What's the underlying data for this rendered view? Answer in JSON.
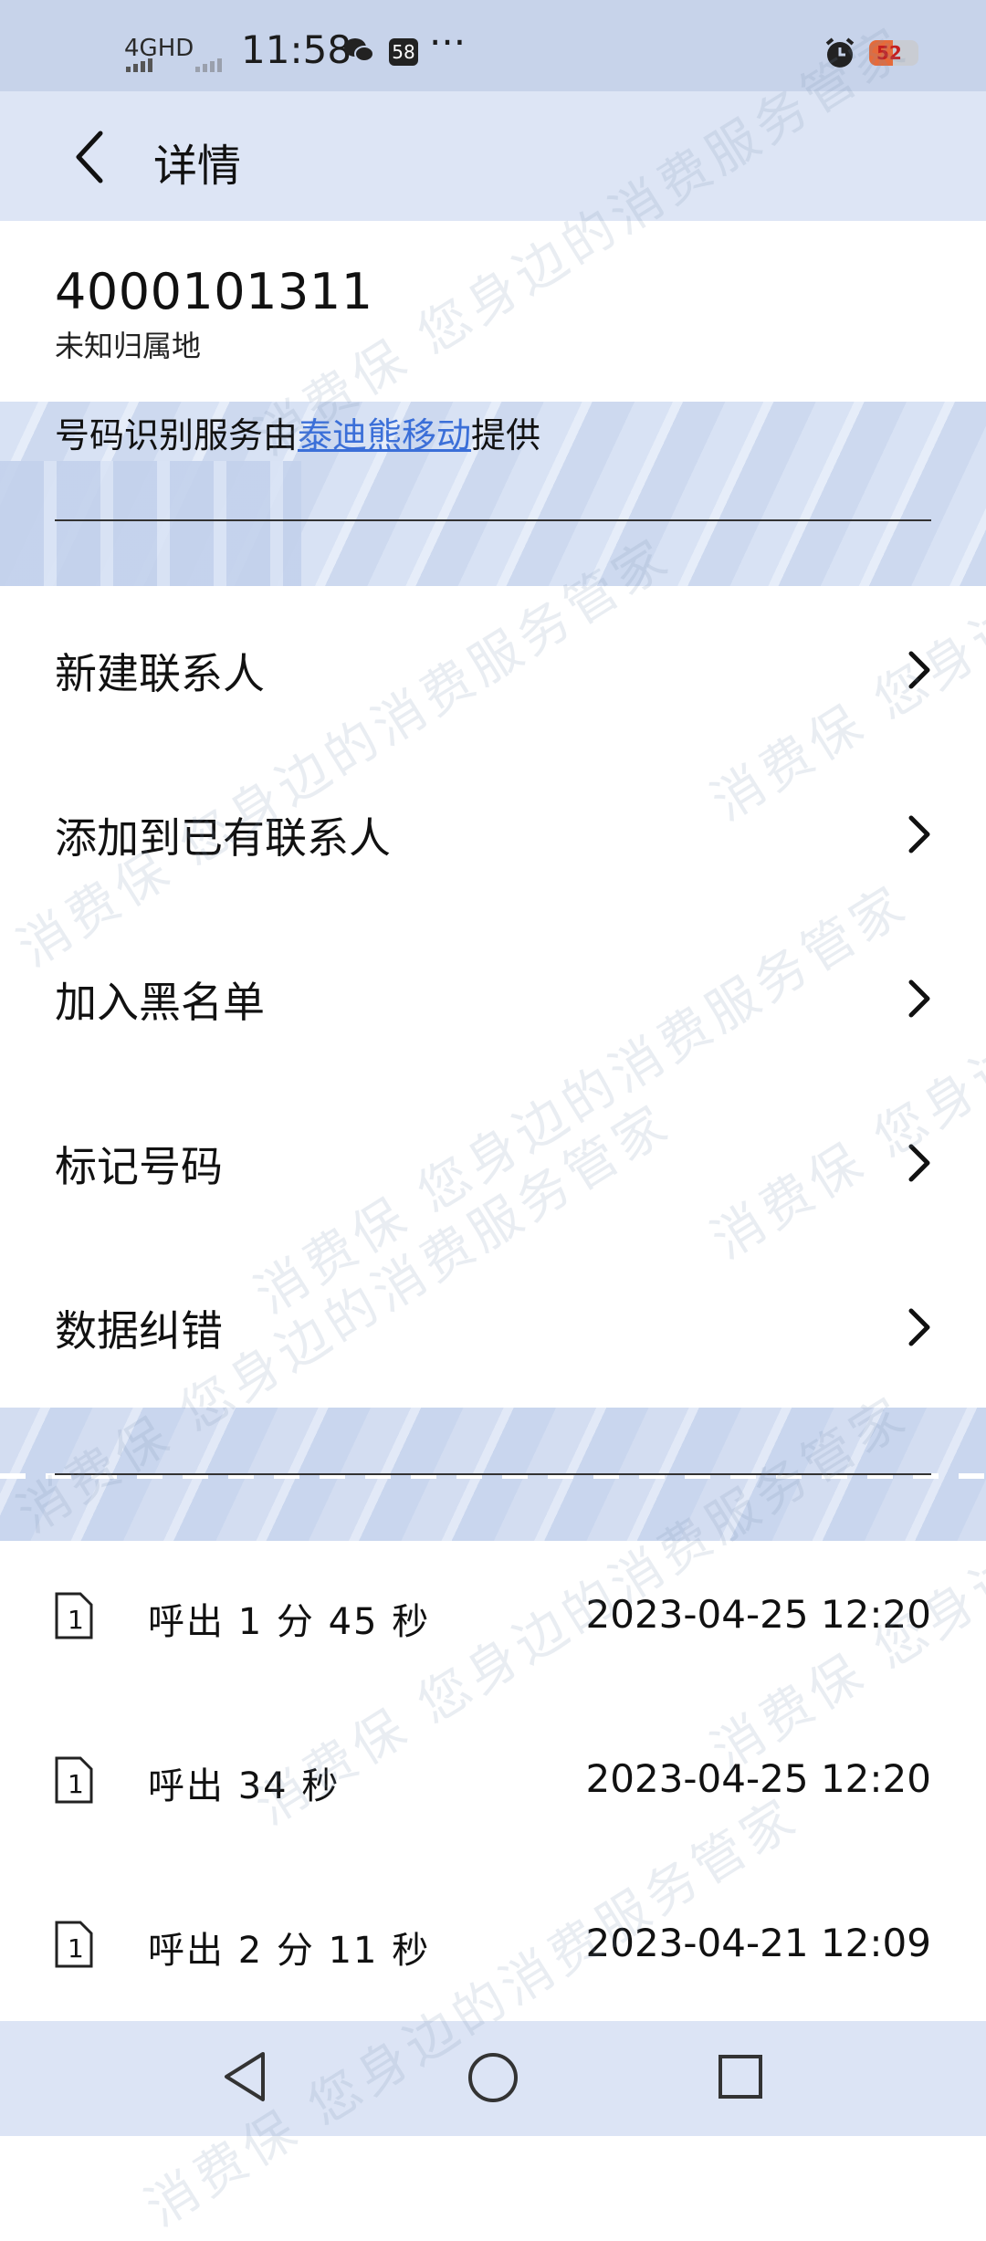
{
  "status_bar": {
    "network": "4GHD",
    "time": "11:58",
    "notification_count": "58",
    "more": "···",
    "battery": "52"
  },
  "header": {
    "title": "详情"
  },
  "caller": {
    "number": "4000101311",
    "location": "未知归属地",
    "provider_prefix": "号码识别服务由",
    "provider_link": "泰迪熊移动",
    "provider_suffix": "提供"
  },
  "menu": [
    {
      "label": "新建联系人"
    },
    {
      "label": "添加到已有联系人"
    },
    {
      "label": "加入黑名单"
    },
    {
      "label": "标记号码"
    },
    {
      "label": "数据纠错"
    }
  ],
  "call_logs": [
    {
      "sim": "1",
      "type": "呼出 1 分 45 秒",
      "time": "2023-04-25 12:20"
    },
    {
      "sim": "1",
      "type": "呼出 34 秒",
      "time": "2023-04-25 12:20"
    },
    {
      "sim": "1",
      "type": "呼出 2 分 11 秒",
      "time": "2023-04-21 12:09"
    }
  ],
  "watermark": "消费保 您身边的消费服务管家",
  "colors": {
    "accent_link": "#3b6fd8",
    "header_bg": "#dde5f5",
    "status_bg": "#c7d3ea"
  }
}
